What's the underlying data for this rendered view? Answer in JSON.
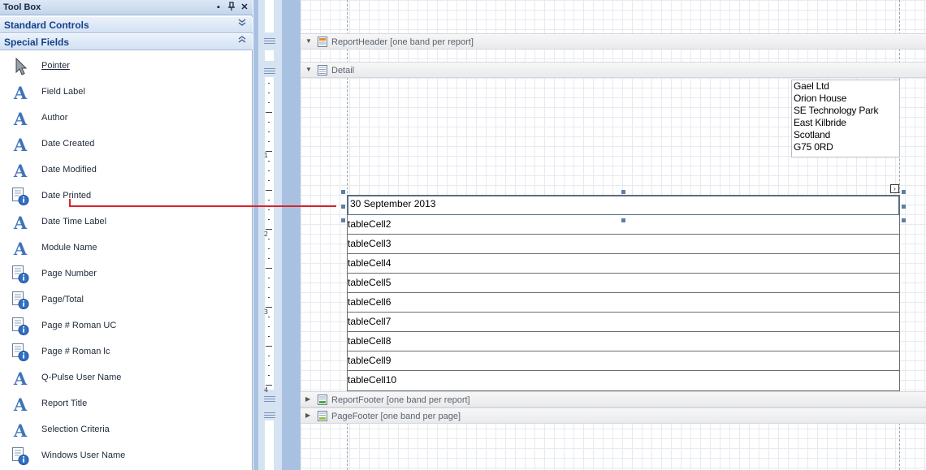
{
  "toolbox": {
    "title": "Tool Box",
    "title_controls": [
      "▪",
      "╤",
      "✕"
    ],
    "sections": [
      {
        "label": "Standard Controls",
        "chevron": "˅˅"
      },
      {
        "label": "Special Fields",
        "chevron": "˄˄"
      }
    ],
    "items": [
      {
        "label": "Pointer",
        "icon": "pointer-icon"
      },
      {
        "label": "Field Label",
        "icon": "text-a-icon"
      },
      {
        "label": "Author",
        "icon": "text-a-icon"
      },
      {
        "label": "Date Created",
        "icon": "text-a-icon"
      },
      {
        "label": "Date Modified",
        "icon": "text-a-icon"
      },
      {
        "label": "Date Printed",
        "icon": "info-page-icon"
      },
      {
        "label": "Date Time Label",
        "icon": "text-a-icon"
      },
      {
        "label": "Module Name",
        "icon": "text-a-icon"
      },
      {
        "label": "Page Number",
        "icon": "info-page-icon"
      },
      {
        "label": "Page/Total",
        "icon": "info-page-icon"
      },
      {
        "label": "Page # Roman UC",
        "icon": "info-page-icon"
      },
      {
        "label": "Page # Roman lc",
        "icon": "info-page-icon"
      },
      {
        "label": "Q-Pulse User Name",
        "icon": "text-a-icon"
      },
      {
        "label": "Report Title",
        "icon": "text-a-icon"
      },
      {
        "label": "Selection Criteria",
        "icon": "text-a-icon"
      },
      {
        "label": "Windows User Name",
        "icon": "info-page-icon"
      }
    ]
  },
  "ruler": {
    "numbers": [
      "1",
      "2",
      "3",
      "4"
    ]
  },
  "bands": {
    "report_header": "ReportHeader [one band per report]",
    "detail": "Detail",
    "report_footer": "ReportFooter [one band per report]",
    "page_footer": "PageFooter [one band per page]"
  },
  "address": [
    "Gael Ltd",
    "Orion House",
    "SE Technology Park",
    "East Kilbride",
    "Scotland",
    "G75 0RD"
  ],
  "table": {
    "rows": [
      "30 September 2013",
      "tableCell2",
      "tableCell3",
      "tableCell4",
      "tableCell5",
      "tableCell6",
      "tableCell7",
      "tableCell8",
      "tableCell9",
      "tableCell10"
    ]
  },
  "smart_tag": "›",
  "colors": {
    "drag_line": "#d9252b",
    "toolbox_header": "#15428b",
    "ruler_bg": "#a9c1e1"
  }
}
